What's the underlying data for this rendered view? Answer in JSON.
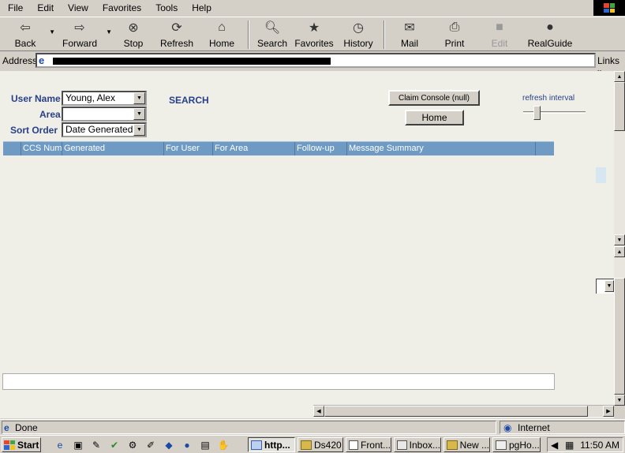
{
  "menu": [
    "File",
    "Edit",
    "View",
    "Favorites",
    "Tools",
    "Help"
  ],
  "toolbar": {
    "back": "Back",
    "forward": "Forward",
    "stop": "Stop",
    "refresh": "Refresh",
    "home": "Home",
    "search": "Search",
    "favorites": "Favorites",
    "history": "History",
    "mail": "Mail",
    "print": "Print",
    "edit": "Edit",
    "realguide": "RealGuide"
  },
  "address": {
    "label": "Address",
    "links": "Links"
  },
  "form": {
    "user_name_label": "User Name",
    "user_name_value": "Young, Alex",
    "area_label": "Area",
    "area_value": "",
    "sort_order_label": "Sort Order",
    "sort_order_value": "Date Generated",
    "search_link": "SEARCH",
    "claim_console_button": "Claim Console (null)",
    "home_button": "Home",
    "refresh_interval_label": "refresh interval"
  },
  "grid": {
    "columns": [
      "CCS Num",
      "Generated",
      "For User",
      "For Area",
      "Follow-up",
      "Message Summary"
    ],
    "rows": []
  },
  "status": {
    "text": "Done",
    "zone": "Internet"
  },
  "taskbar": {
    "start": "Start",
    "tasks": [
      "http...",
      "Ds420",
      "Front...",
      "Inbox...",
      "New ...",
      "pgHo..."
    ],
    "clock": "11:50 AM"
  },
  "colors": {
    "grid_header": "#6e9ac4",
    "label_blue": "#27408b"
  }
}
